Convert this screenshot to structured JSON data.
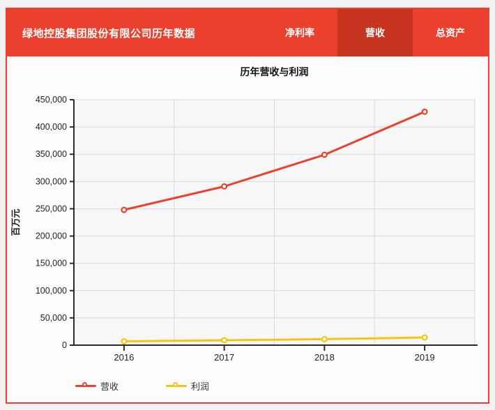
{
  "header": {
    "title": "绿地控股集团股份有限公司历年数据",
    "tabs": [
      {
        "label": "净利率",
        "active": false
      },
      {
        "label": "营收",
        "active": true
      },
      {
        "label": "总资产",
        "active": false
      }
    ]
  },
  "colors": {
    "accent_red": "#eb402e",
    "active_tab_red": "#c73520",
    "revenue_red": "#eb402e",
    "profit_gold": "#f3c612",
    "grid": "#d8d8d8",
    "plot_bg": "#f7f7f7",
    "axis": "#2b2b2b"
  },
  "chart_data": {
    "type": "line",
    "title": "历年营收与利润",
    "ylabel": "百万元",
    "xlabel": "",
    "categories": [
      "2016",
      "2017",
      "2018",
      "2019"
    ],
    "series": [
      {
        "name": "营收",
        "color": "#eb402e",
        "values": [
          248000,
          291000,
          349000,
          428000
        ]
      },
      {
        "name": "利润",
        "color": "#f3c612",
        "values": [
          7000,
          9000,
          11000,
          14000
        ]
      }
    ],
    "ylim": [
      0,
      450000
    ],
    "y_tick_step": 50000,
    "y_tick_labels": [
      "0",
      "50,000",
      "100,000",
      "150,000",
      "200,000",
      "250,000",
      "300,000",
      "350,000",
      "400,000",
      "450,000"
    ],
    "grid": true,
    "legend_position": "bottom-left"
  }
}
